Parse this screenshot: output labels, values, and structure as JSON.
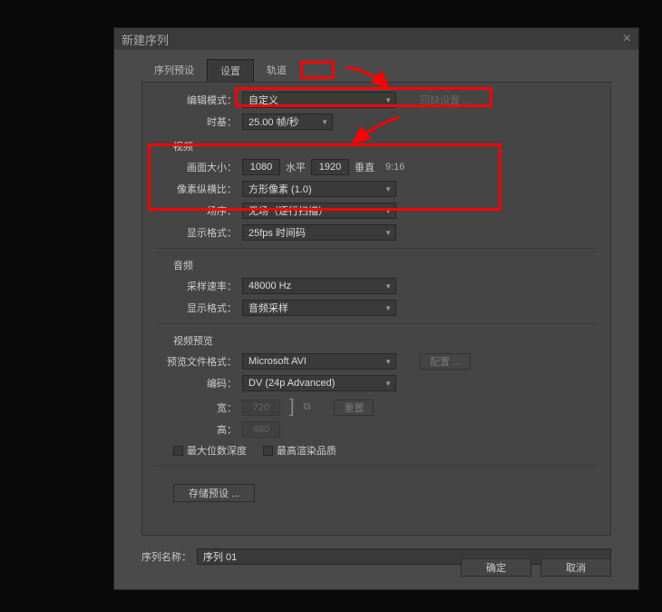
{
  "dialog": {
    "title": "新建序列",
    "tabs": {
      "presets": "序列预设",
      "settings": "设置",
      "tracks": "轨道"
    },
    "edit_mode_label": "编辑模式：",
    "edit_mode_value": "自定义",
    "recover_settings": "回缺设置 ...",
    "timebase_label": "时基：",
    "timebase_value": "25.00 帧/秒",
    "video_section": "视频",
    "frame_size_label": "画面大小：",
    "width": "1080",
    "horiz": "水平",
    "height": "1920",
    "vert": "垂直",
    "aspect": "9:16",
    "par_label": "像素纵横比：",
    "par_value": "方形像素 (1.0)",
    "fields_label": "场序：",
    "fields_value": "无场（逐行扫描）",
    "disp_fmt_label": "显示格式：",
    "disp_fmt_value": "25fps 时间码",
    "audio_section": "音频",
    "sample_rate_label": "采样速率：",
    "sample_rate_value": "48000 Hz",
    "audio_disp_label": "显示格式：",
    "audio_disp_value": "音频采样",
    "preview_section": "视频预览",
    "preview_fmt_label": "预览文件格式：",
    "preview_fmt_value": "Microsoft AVI",
    "config_btn": "配置 ...",
    "codec_label": "编码：",
    "codec_value": "DV (24p Advanced)",
    "pw_label": "宽：",
    "pw_value": "720",
    "ph_label": "高：",
    "ph_value": "480",
    "reset_btn": "重置",
    "max_depth": "最大位数深度",
    "max_quality": "最高渲染品质",
    "save_preset": "存储预设 ...",
    "seq_name_label": "序列名称：",
    "seq_name_value": "序列 01",
    "ok": "确定",
    "cancel": "取消"
  }
}
